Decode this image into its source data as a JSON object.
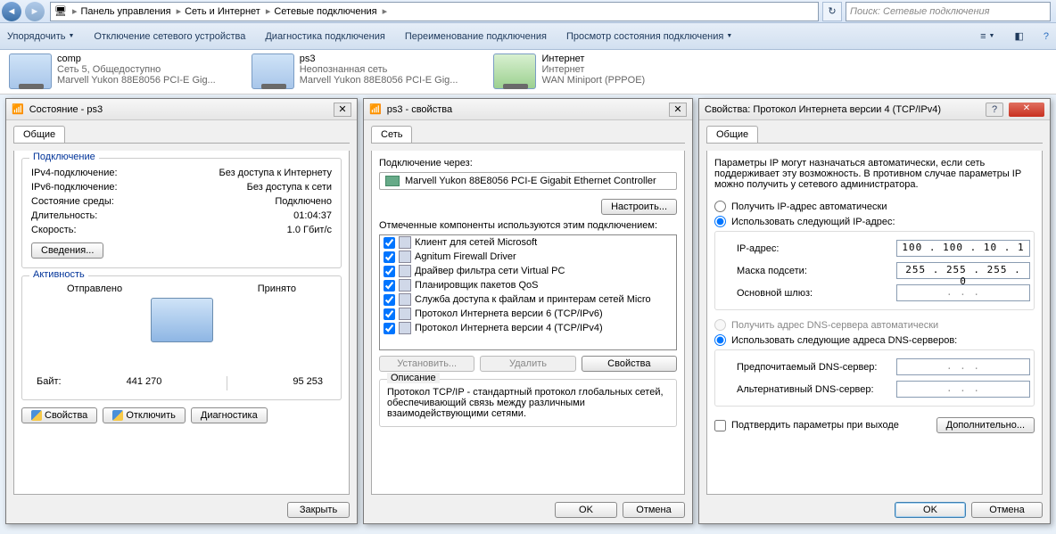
{
  "nav": {
    "breadcrumb": [
      "Панель управления",
      "Сеть и Интернет",
      "Сетевые подключения"
    ],
    "search_placeholder": "Поиск: Сетевые подключения"
  },
  "cmdbar": {
    "organize": "Упорядочить",
    "disable": "Отключение сетевого устройства",
    "diagnose": "Диагностика подключения",
    "rename": "Переименование подключения",
    "status": "Просмотр состояния подключения"
  },
  "connections": [
    {
      "name": "comp",
      "line2": "Сеть 5, Общедоступно",
      "line3": "Marvell Yukon 88E8056 PCI-E Gig..."
    },
    {
      "name": "ps3",
      "line2": "Неопознанная сеть",
      "line3": "Marvell Yukon 88E8056 PCI-E Gig..."
    },
    {
      "name": "Интернет",
      "line2": "Интернет",
      "line3": "WAN Miniport (PPPOE)"
    }
  ],
  "status_dlg": {
    "title": "Состояние - ps3",
    "tab": "Общие",
    "group_conn": "Подключение",
    "ipv4_lbl": "IPv4-подключение:",
    "ipv4_val": "Без доступа к Интернету",
    "ipv6_lbl": "IPv6-подключение:",
    "ipv6_val": "Без доступа к сети",
    "media_lbl": "Состояние среды:",
    "media_val": "Подключено",
    "dur_lbl": "Длительность:",
    "dur_val": "01:04:37",
    "speed_lbl": "Скорость:",
    "speed_val": "1.0 Гбит/с",
    "details_btn": "Сведения...",
    "activity": "Активность",
    "sent": "Отправлено",
    "recv": "Принято",
    "bytes_lbl": "Байт:",
    "bytes_sent": "441 270",
    "bytes_recv": "95 253",
    "props_btn": "Свойства",
    "disable_btn": "Отключить",
    "diag_btn": "Диагностика",
    "close_btn": "Закрыть"
  },
  "props_dlg": {
    "title": "ps3 - свойства",
    "tab": "Сеть",
    "connect_using": "Подключение через:",
    "adapter": "Marvell Yukon 88E8056 PCI-E Gigabit Ethernet Controller",
    "configure_btn": "Настроить...",
    "components_lbl": "Отмеченные компоненты используются этим подключением:",
    "components": [
      "Клиент для сетей Microsoft",
      "Agnitum Firewall Driver",
      "Драйвер фильтра сети Virtual PC",
      "Планировщик пакетов QoS",
      "Служба доступа к файлам и принтерам сетей Micro",
      "Протокол Интернета версии 6 (TCP/IPv6)",
      "Протокол Интернета версии 4 (TCP/IPv4)"
    ],
    "install_btn": "Установить...",
    "remove_btn": "Удалить",
    "props_btn": "Свойства",
    "desc_title": "Описание",
    "desc_text": "Протокол TCP/IP - стандартный протокол глобальных сетей, обеспечивающий связь между различными взаимодействующими сетями.",
    "ok": "OK",
    "cancel": "Отмена"
  },
  "ipv4_dlg": {
    "title": "Свойства: Протокол Интернета версии 4 (TCP/IPv4)",
    "tab": "Общие",
    "intro": "Параметры IP могут назначаться автоматически, если сеть поддерживает эту возможность. В противном случае параметры IP можно получить у сетевого администратора.",
    "auto_ip": "Получить IP-адрес автоматически",
    "use_ip": "Использовать следующий IP-адрес:",
    "ip_lbl": "IP-адрес:",
    "ip_val": "100 . 100 . 10 .  1",
    "mask_lbl": "Маска подсети:",
    "mask_val": "255 . 255 . 255 .  0",
    "gw_lbl": "Основной шлюз:",
    "gw_val": " .       .       . ",
    "auto_dns": "Получить адрес DNS-сервера автоматически",
    "use_dns": "Использовать следующие адреса DNS-серверов:",
    "dns1_lbl": "Предпочитаемый DNS-сервер:",
    "dns1_val": " .       .       . ",
    "dns2_lbl": "Альтернативный DNS-сервер:",
    "dns2_val": " .       .       . ",
    "validate": "Подтвердить параметры при выходе",
    "advanced": "Дополнительно...",
    "ok": "OK",
    "cancel": "Отмена"
  }
}
